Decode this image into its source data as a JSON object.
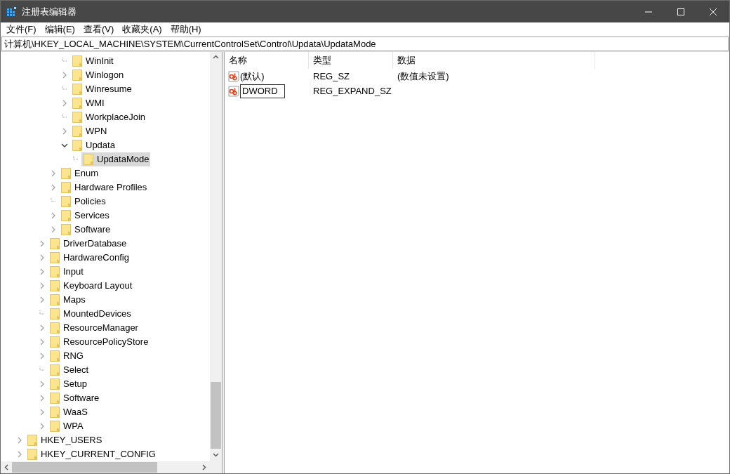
{
  "window": {
    "title": "注册表编辑器"
  },
  "menu": [
    "文件(F)",
    "编辑(E)",
    "查看(V)",
    "收藏夹(A)",
    "帮助(H)"
  ],
  "address": "计算机\\HKEY_LOCAL_MACHINE\\SYSTEM\\CurrentControlSet\\Control\\Updata\\UpdataMode",
  "tree": [
    {
      "children": [
        {
          "children": [
            {
              "children": [
                {
                  "children": [
                    {
                      "children": [
                        {
                          "label": "WinInit",
                          "kind": "leaf",
                          "selected": false
                        },
                        {
                          "label": "Winlogon",
                          "kind": "branch",
                          "expanded": false,
                          "selected": false
                        },
                        {
                          "label": "Winresume",
                          "kind": "leaf",
                          "selected": false
                        },
                        {
                          "label": "WMI",
                          "kind": "branch",
                          "expanded": false,
                          "selected": false
                        },
                        {
                          "label": "WorkplaceJoin",
                          "kind": "leaf",
                          "selected": false
                        },
                        {
                          "label": "WPN",
                          "kind": "branch",
                          "expanded": false,
                          "selected": false
                        },
                        {
                          "label": "Updata",
                          "kind": "branch",
                          "expanded": true,
                          "selected": false,
                          "children": [
                            {
                              "label": "UpdataMode",
                              "kind": "leaf",
                              "selected": true
                            }
                          ]
                        }
                      ]
                    },
                    {
                      "label": "Enum",
                      "kind": "branch",
                      "expanded": false,
                      "selected": false
                    },
                    {
                      "label": "Hardware Profiles",
                      "kind": "branch",
                      "expanded": false,
                      "selected": false
                    },
                    {
                      "label": "Policies",
                      "kind": "leaf",
                      "selected": false
                    },
                    {
                      "label": "Services",
                      "kind": "branch",
                      "expanded": false,
                      "selected": false
                    },
                    {
                      "label": "Software",
                      "kind": "branch",
                      "expanded": false,
                      "selected": false
                    }
                  ]
                },
                {
                  "label": "DriverDatabase",
                  "kind": "branch",
                  "expanded": false,
                  "selected": false
                },
                {
                  "label": "HardwareConfig",
                  "kind": "branch",
                  "expanded": false,
                  "selected": false
                },
                {
                  "label": "Input",
                  "kind": "branch",
                  "expanded": false,
                  "selected": false
                },
                {
                  "label": "Keyboard Layout",
                  "kind": "branch",
                  "expanded": false,
                  "selected": false
                },
                {
                  "label": "Maps",
                  "kind": "branch",
                  "expanded": false,
                  "selected": false
                },
                {
                  "label": "MountedDevices",
                  "kind": "leaf",
                  "selected": false
                },
                {
                  "label": "ResourceManager",
                  "kind": "branch",
                  "expanded": false,
                  "selected": false
                },
                {
                  "label": "ResourcePolicyStore",
                  "kind": "branch",
                  "expanded": false,
                  "selected": false
                },
                {
                  "label": "RNG",
                  "kind": "branch",
                  "expanded": false,
                  "selected": false
                },
                {
                  "label": "Select",
                  "kind": "leaf",
                  "selected": false
                },
                {
                  "label": "Setup",
                  "kind": "branch",
                  "expanded": false,
                  "selected": false
                },
                {
                  "label": "Software",
                  "kind": "branch",
                  "expanded": false,
                  "selected": false
                },
                {
                  "label": "WaaS",
                  "kind": "branch",
                  "expanded": false,
                  "selected": false
                },
                {
                  "label": "WPA",
                  "kind": "branch",
                  "expanded": false,
                  "selected": false
                }
              ]
            }
          ]
        },
        {
          "label": "HKEY_USERS",
          "kind": "branch",
          "expanded": false,
          "selected": false
        },
        {
          "label": "HKEY_CURRENT_CONFIG",
          "kind": "branch",
          "expanded": false,
          "selected": false
        }
      ]
    }
  ],
  "values": {
    "columns": [
      "名称",
      "类型",
      "数据"
    ],
    "rows": [
      {
        "name": "(默认)",
        "type": "REG_SZ",
        "data": "(数值未设置)",
        "editing": false
      },
      {
        "name": "DWORD",
        "type": "REG_EXPAND_SZ",
        "editing": true
      }
    ]
  }
}
